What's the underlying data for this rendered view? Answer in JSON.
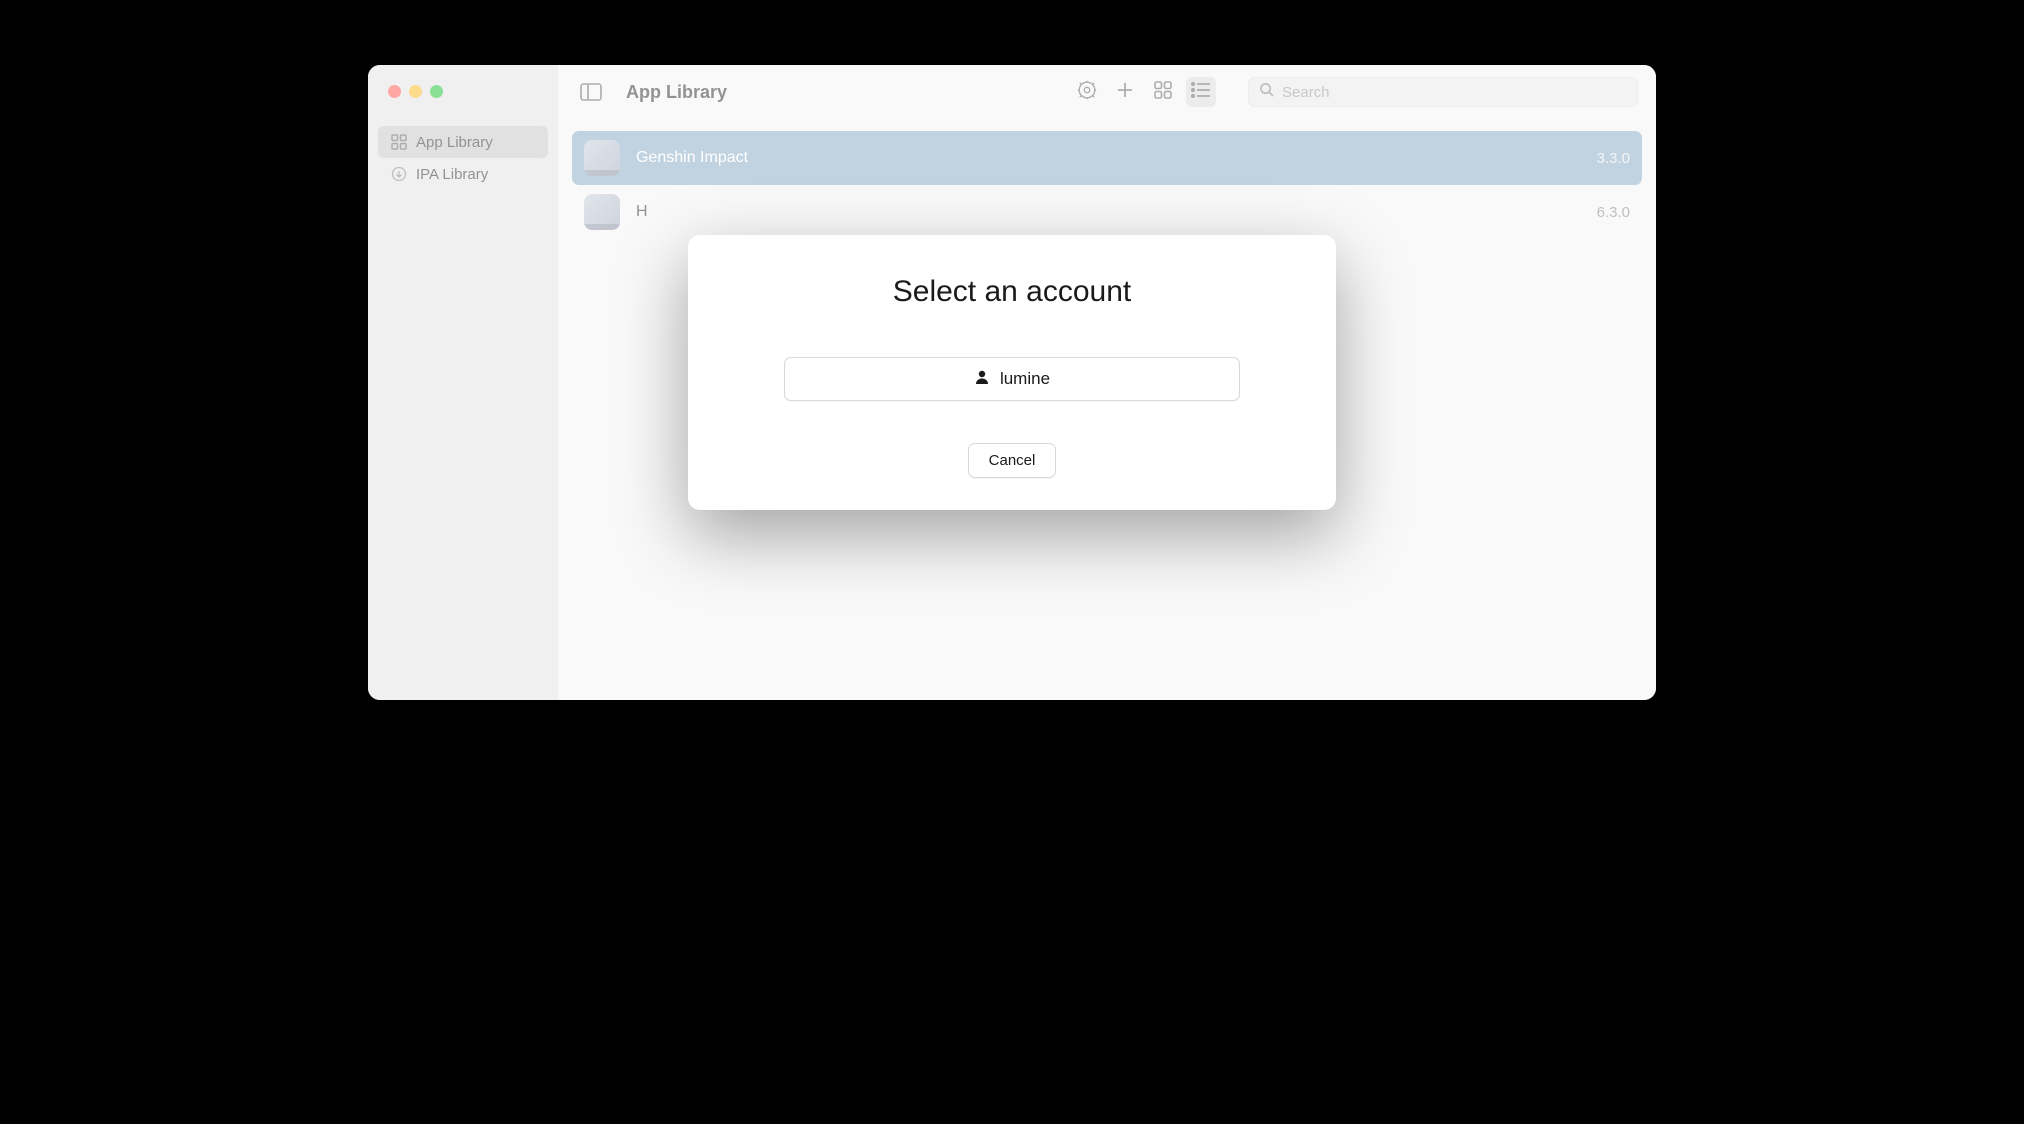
{
  "window": {
    "title": "App Library"
  },
  "sidebar": {
    "items": [
      {
        "label": "App Library",
        "active": true
      },
      {
        "label": "IPA Library",
        "active": false
      }
    ]
  },
  "toolbar": {
    "search_placeholder": "Search"
  },
  "apps": [
    {
      "name": "Genshin Impact",
      "version": "3.3.0",
      "selected": true
    },
    {
      "name": "H",
      "version": "6.3.0",
      "selected": false
    }
  ],
  "modal": {
    "title": "Select an account",
    "account_name": "lumine",
    "cancel_label": "Cancel"
  }
}
